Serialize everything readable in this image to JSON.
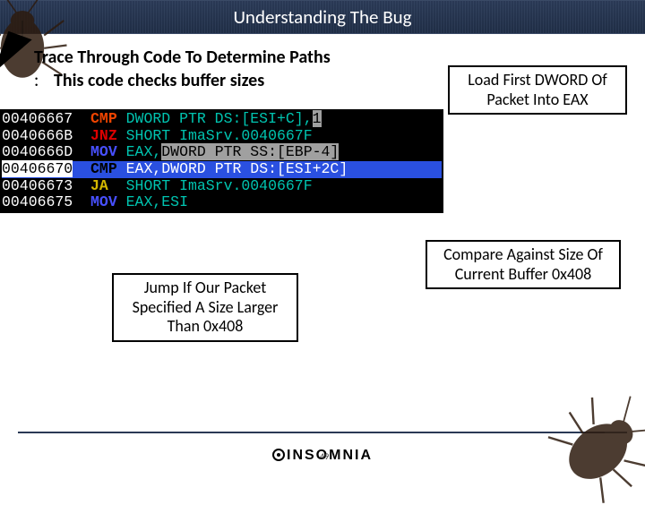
{
  "title": "Understanding The Bug",
  "subtitle": "Trace Through Code To Determine Paths",
  "bullet": "This code checks buffer sizes",
  "callouts": {
    "c1": "Load First DWORD Of Packet Into EAX",
    "c2": "Compare Against Size Of Current Buffer 0x408",
    "c3": "Jump If Our Packet Specified A Size Larger Than 0x408"
  },
  "disasm": [
    {
      "addr": "00406667",
      "mn": "CMP",
      "mncls": "mn-cmp",
      "ops": "DWORD PTR DS:[ESI+C]",
      "comma": ",",
      "tail": "1",
      "sel": false
    },
    {
      "addr": "0040666B",
      "mn": "JNZ",
      "mncls": "mn-jnz",
      "ops": "SHORT ImaSrv.0040667F",
      "comma": "",
      "tail": "",
      "sel": false
    },
    {
      "addr": "0040666D",
      "mn": "MOV",
      "mncls": "mn-mov",
      "ops_a": "EAX",
      "ops_b": "DWORD PTR SS:[EBP-4]",
      "sel": false
    },
    {
      "addr": "00406670",
      "mn": "CMP",
      "mncls": "mn-cmp",
      "ops_a": "EAX",
      "ops_b": "DWORD PTR DS:[ESI+2C]",
      "sel": true
    },
    {
      "addr": "00406673",
      "mn": "JA",
      "mncls": "mn-ja",
      "ops": "SHORT ImaSrv.0040667F",
      "comma": "",
      "tail": "",
      "sel": false
    },
    {
      "addr": "00406675",
      "mn": "MOV",
      "mncls": "mn-mov",
      "ops_a": "EAX",
      "ops_b": "ESI",
      "sel": false,
      "plain": true
    }
  ],
  "footer": {
    "brand": "INSOMNIA",
    "page": "49"
  }
}
